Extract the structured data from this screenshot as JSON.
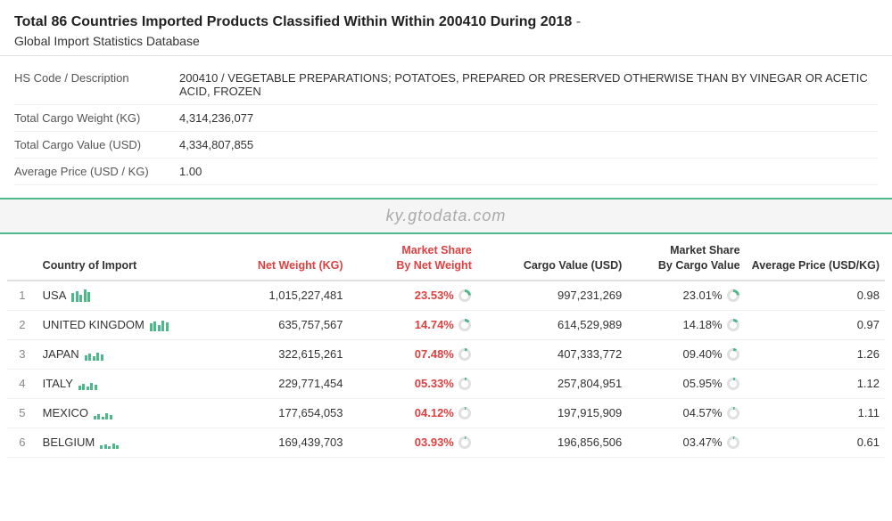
{
  "header": {
    "title_main": "Total 86 Countries Imported Products Classified Within Within 200410 During 2018",
    "title_dash": " - ",
    "title_sub": "Global Import Statistics Database",
    "watermark": "ky.gtodata.com"
  },
  "info": {
    "hs_label": "HS Code / Description",
    "hs_value": "200410 / VEGETABLE PREPARATIONS; POTATOES, PREPARED OR PRESERVED OTHERWISE THAN BY VINEGAR OR ACETIC ACID, FROZEN",
    "weight_label": "Total Cargo Weight (KG)",
    "weight_value": "4,314,236,077",
    "value_label": "Total Cargo Value (USD)",
    "value_value": "4,334,807,855",
    "avg_label": "Average Price (USD / KG)",
    "avg_value": "1.00"
  },
  "table": {
    "columns": [
      "",
      "Country of Import",
      "Net Weight (KG)",
      "Market Share By Net Weight",
      "Cargo Value (USD)",
      "Market Share By Cargo Value",
      "Average Price (USD/KG)"
    ],
    "rows": [
      {
        "num": "1",
        "country": "USA",
        "net_weight": "1,015,227,481",
        "mkt_net": "23.53%",
        "cargo_value": "997,231,269",
        "mkt_cargo": "23.01%",
        "avg_price": "0.98"
      },
      {
        "num": "2",
        "country": "UNITED KINGDOM",
        "net_weight": "635,757,567",
        "mkt_net": "14.74%",
        "cargo_value": "614,529,989",
        "mkt_cargo": "14.18%",
        "avg_price": "0.97"
      },
      {
        "num": "3",
        "country": "JAPAN",
        "net_weight": "322,615,261",
        "mkt_net": "07.48%",
        "cargo_value": "407,333,772",
        "mkt_cargo": "09.40%",
        "avg_price": "1.26"
      },
      {
        "num": "4",
        "country": "ITALY",
        "net_weight": "229,771,454",
        "mkt_net": "05.33%",
        "cargo_value": "257,804,951",
        "mkt_cargo": "05.95%",
        "avg_price": "1.12"
      },
      {
        "num": "5",
        "country": "MEXICO",
        "net_weight": "177,654,053",
        "mkt_net": "04.12%",
        "cargo_value": "197,915,909",
        "mkt_cargo": "04.57%",
        "avg_price": "1.11"
      },
      {
        "num": "6",
        "country": "BELGIUM",
        "net_weight": "169,439,703",
        "mkt_net": "03.93%",
        "cargo_value": "196,856,506",
        "mkt_cargo": "03.47%",
        "avg_price": "0.61"
      }
    ]
  },
  "colors": {
    "accent_green": "#4db88a",
    "red_header": "#e04040"
  }
}
